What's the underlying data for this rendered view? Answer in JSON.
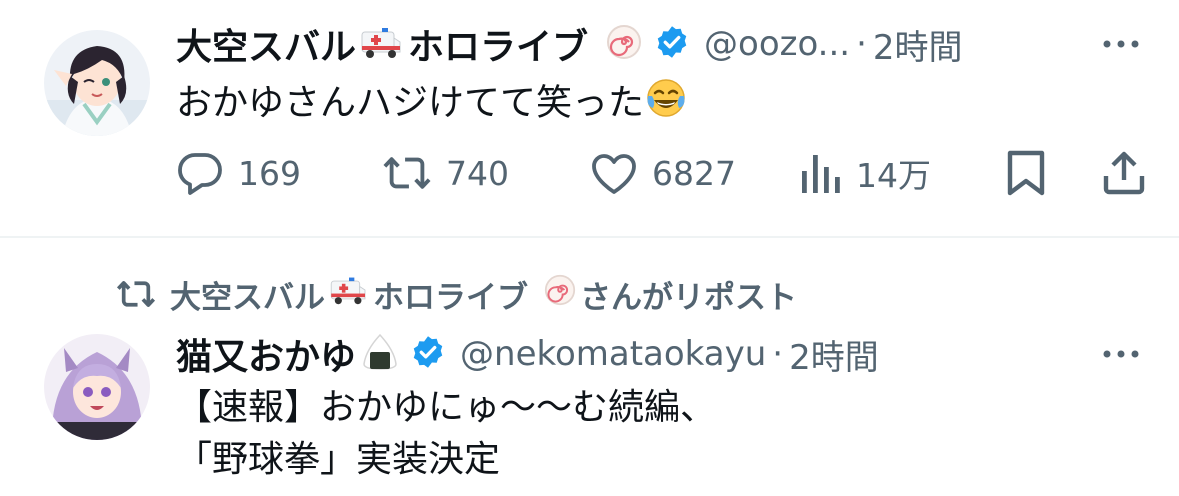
{
  "tweets": [
    {
      "display_name": "大空スバル",
      "name_suffix": "ホロライブ",
      "name_emoji": "ambulance-emoji",
      "badge_emoji": "naruto-fishcake-emoji",
      "verified": true,
      "handle": "@oozo...",
      "separator": "·",
      "time": "2時間",
      "text": "おかゆさんハジけてて笑った",
      "text_emoji": "tears-of-joy-emoji",
      "actions": {
        "replies": "169",
        "reposts": "740",
        "likes": "6827",
        "views": "14万"
      }
    },
    {
      "repost_by": "大空スバル",
      "repost_by_suffix": "ホロライブ",
      "repost_label": "さんがリポスト",
      "display_name": "猫又おかゆ",
      "name_emoji": "rice-ball-emoji",
      "verified": true,
      "handle": "@nekomataokayu",
      "separator": "·",
      "time": "2時間",
      "text_line1": "【速報】おかゆにゅ〜〜む続編、",
      "text_line2": "「野球拳」実装決定"
    }
  ],
  "colors": {
    "text": "#0f1419",
    "secondary": "#536471",
    "verified": "#1d9bf0",
    "divider": "#eff3f4"
  }
}
